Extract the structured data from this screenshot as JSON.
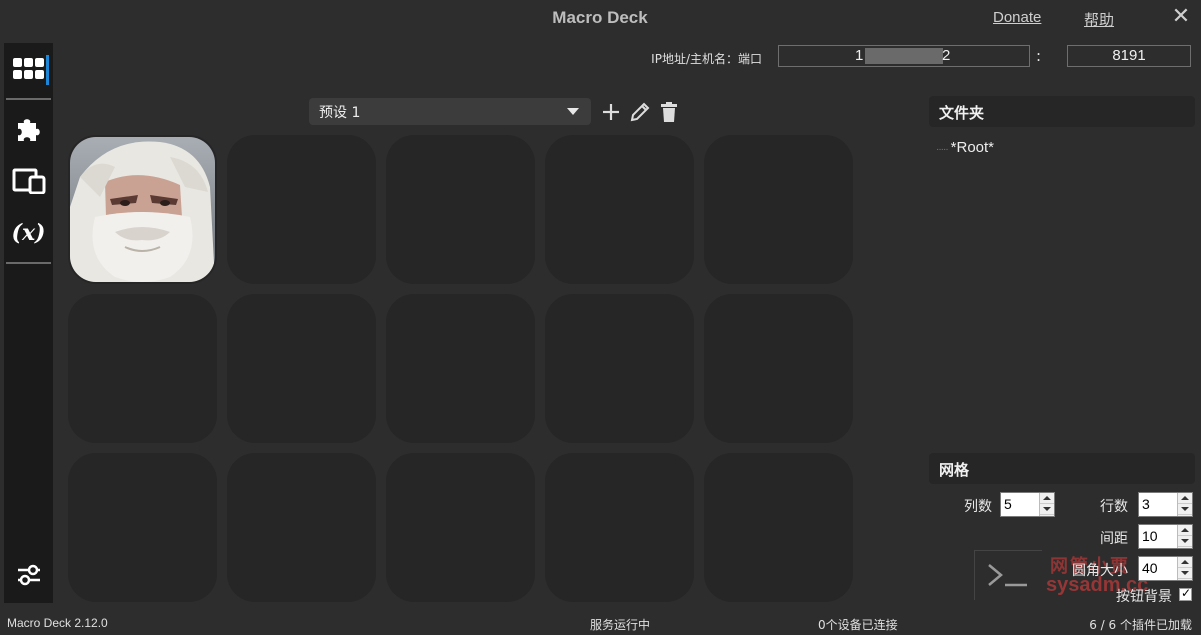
{
  "window": {
    "title": "Macro Deck",
    "donate": "Donate",
    "help": "帮助",
    "close": "✕"
  },
  "sidebar": {
    "items": [
      {
        "icon": "deck-grid-icon",
        "active": true
      },
      {
        "icon": "puzzle-plugin-icon"
      },
      {
        "icon": "devices-icon"
      },
      {
        "icon": "variables-icon",
        "label": "(x)"
      },
      {
        "icon": "settings-sliders-icon"
      }
    ]
  },
  "connection": {
    "label": "IP地址/主机名：端口",
    "ip_start": "1",
    "ip_end": "2",
    "colon": ":",
    "port": "8191"
  },
  "profile": {
    "selected": "预设 1"
  },
  "folders": {
    "title": "文件夹",
    "root": "*Root*"
  },
  "grid_settings": {
    "title": "网格",
    "columns_label": "列数",
    "columns": "5",
    "rows_label": "行数",
    "rows": "3",
    "spacing_label": "间距",
    "spacing": "10",
    "radius_label": "圆角大小",
    "radius": "40",
    "bg_label": "按钮背景",
    "bg_checked": true
  },
  "watermark": {
    "cn": "网管小贾",
    "en": "sysadm.cc"
  },
  "status": {
    "version": "Macro Deck 2.12.0",
    "service": "服务运行中",
    "devices": "0个设备已连接",
    "plugins": "6 / 6 个插件已加载"
  },
  "colors": {
    "accent": "#1e86d6",
    "background": "#2d2d2d",
    "sidebar": "#1a1a1a",
    "button": "#262626"
  }
}
